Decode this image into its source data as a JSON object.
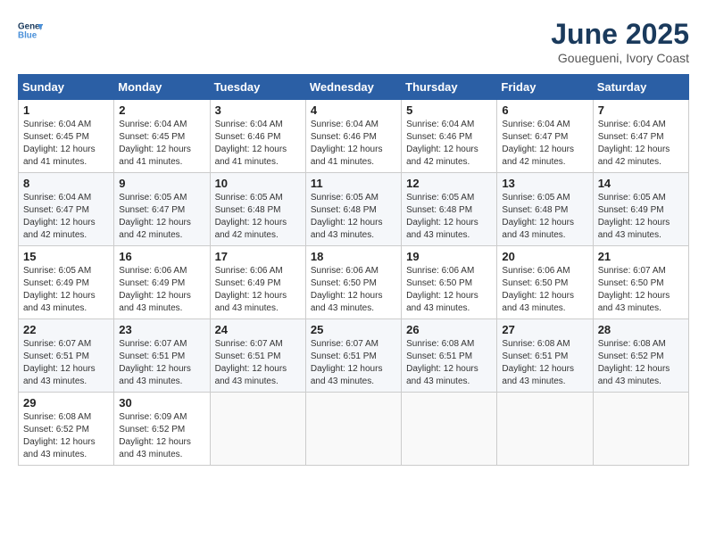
{
  "header": {
    "logo_line1": "General",
    "logo_line2": "Blue",
    "title": "June 2025",
    "subtitle": "Gouegueni, Ivory Coast"
  },
  "calendar": {
    "days_of_week": [
      "Sunday",
      "Monday",
      "Tuesday",
      "Wednesday",
      "Thursday",
      "Friday",
      "Saturday"
    ],
    "weeks": [
      [
        {
          "day": "1",
          "sunrise": "6:04 AM",
          "sunset": "6:45 PM",
          "daylight": "12 hours and 41 minutes."
        },
        {
          "day": "2",
          "sunrise": "6:04 AM",
          "sunset": "6:45 PM",
          "daylight": "12 hours and 41 minutes."
        },
        {
          "day": "3",
          "sunrise": "6:04 AM",
          "sunset": "6:46 PM",
          "daylight": "12 hours and 41 minutes."
        },
        {
          "day": "4",
          "sunrise": "6:04 AM",
          "sunset": "6:46 PM",
          "daylight": "12 hours and 41 minutes."
        },
        {
          "day": "5",
          "sunrise": "6:04 AM",
          "sunset": "6:46 PM",
          "daylight": "12 hours and 42 minutes."
        },
        {
          "day": "6",
          "sunrise": "6:04 AM",
          "sunset": "6:47 PM",
          "daylight": "12 hours and 42 minutes."
        },
        {
          "day": "7",
          "sunrise": "6:04 AM",
          "sunset": "6:47 PM",
          "daylight": "12 hours and 42 minutes."
        }
      ],
      [
        {
          "day": "8",
          "sunrise": "6:04 AM",
          "sunset": "6:47 PM",
          "daylight": "12 hours and 42 minutes."
        },
        {
          "day": "9",
          "sunrise": "6:05 AM",
          "sunset": "6:47 PM",
          "daylight": "12 hours and 42 minutes."
        },
        {
          "day": "10",
          "sunrise": "6:05 AM",
          "sunset": "6:48 PM",
          "daylight": "12 hours and 42 minutes."
        },
        {
          "day": "11",
          "sunrise": "6:05 AM",
          "sunset": "6:48 PM",
          "daylight": "12 hours and 43 minutes."
        },
        {
          "day": "12",
          "sunrise": "6:05 AM",
          "sunset": "6:48 PM",
          "daylight": "12 hours and 43 minutes."
        },
        {
          "day": "13",
          "sunrise": "6:05 AM",
          "sunset": "6:48 PM",
          "daylight": "12 hours and 43 minutes."
        },
        {
          "day": "14",
          "sunrise": "6:05 AM",
          "sunset": "6:49 PM",
          "daylight": "12 hours and 43 minutes."
        }
      ],
      [
        {
          "day": "15",
          "sunrise": "6:05 AM",
          "sunset": "6:49 PM",
          "daylight": "12 hours and 43 minutes."
        },
        {
          "day": "16",
          "sunrise": "6:06 AM",
          "sunset": "6:49 PM",
          "daylight": "12 hours and 43 minutes."
        },
        {
          "day": "17",
          "sunrise": "6:06 AM",
          "sunset": "6:49 PM",
          "daylight": "12 hours and 43 minutes."
        },
        {
          "day": "18",
          "sunrise": "6:06 AM",
          "sunset": "6:50 PM",
          "daylight": "12 hours and 43 minutes."
        },
        {
          "day": "19",
          "sunrise": "6:06 AM",
          "sunset": "6:50 PM",
          "daylight": "12 hours and 43 minutes."
        },
        {
          "day": "20",
          "sunrise": "6:06 AM",
          "sunset": "6:50 PM",
          "daylight": "12 hours and 43 minutes."
        },
        {
          "day": "21",
          "sunrise": "6:07 AM",
          "sunset": "6:50 PM",
          "daylight": "12 hours and 43 minutes."
        }
      ],
      [
        {
          "day": "22",
          "sunrise": "6:07 AM",
          "sunset": "6:51 PM",
          "daylight": "12 hours and 43 minutes."
        },
        {
          "day": "23",
          "sunrise": "6:07 AM",
          "sunset": "6:51 PM",
          "daylight": "12 hours and 43 minutes."
        },
        {
          "day": "24",
          "sunrise": "6:07 AM",
          "sunset": "6:51 PM",
          "daylight": "12 hours and 43 minutes."
        },
        {
          "day": "25",
          "sunrise": "6:07 AM",
          "sunset": "6:51 PM",
          "daylight": "12 hours and 43 minutes."
        },
        {
          "day": "26",
          "sunrise": "6:08 AM",
          "sunset": "6:51 PM",
          "daylight": "12 hours and 43 minutes."
        },
        {
          "day": "27",
          "sunrise": "6:08 AM",
          "sunset": "6:51 PM",
          "daylight": "12 hours and 43 minutes."
        },
        {
          "day": "28",
          "sunrise": "6:08 AM",
          "sunset": "6:52 PM",
          "daylight": "12 hours and 43 minutes."
        }
      ],
      [
        {
          "day": "29",
          "sunrise": "6:08 AM",
          "sunset": "6:52 PM",
          "daylight": "12 hours and 43 minutes."
        },
        {
          "day": "30",
          "sunrise": "6:09 AM",
          "sunset": "6:52 PM",
          "daylight": "12 hours and 43 minutes."
        },
        null,
        null,
        null,
        null,
        null
      ]
    ]
  },
  "labels": {
    "sunrise_prefix": "Sunrise: ",
    "sunset_prefix": "Sunset: ",
    "daylight_prefix": "Daylight: "
  }
}
